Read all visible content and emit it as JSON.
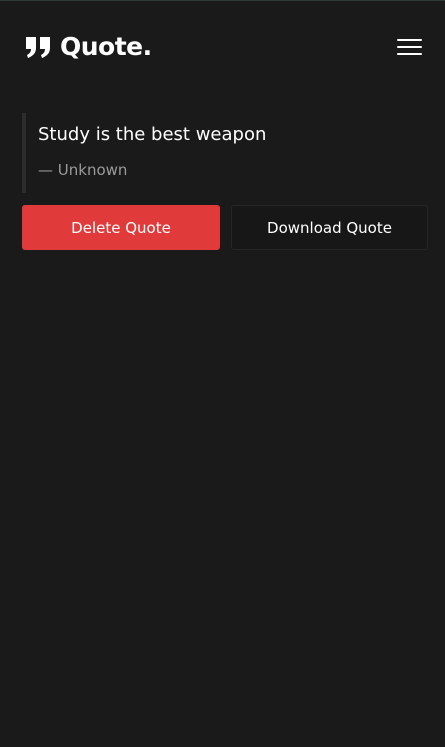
{
  "header": {
    "logo_text": "Quote.",
    "logo_icon": "quote-mark-icon",
    "menu_icon": "hamburger-menu-icon"
  },
  "quote": {
    "text": "Study is the best weapon",
    "author": "— Unknown"
  },
  "actions": {
    "delete_label": "Delete Quote",
    "download_label": "Download Quote"
  },
  "colors": {
    "background": "#1a1a1a",
    "accent_red": "#e03a3a",
    "muted_text": "#9a9a9a",
    "quote_border": "#2c2c2c"
  }
}
